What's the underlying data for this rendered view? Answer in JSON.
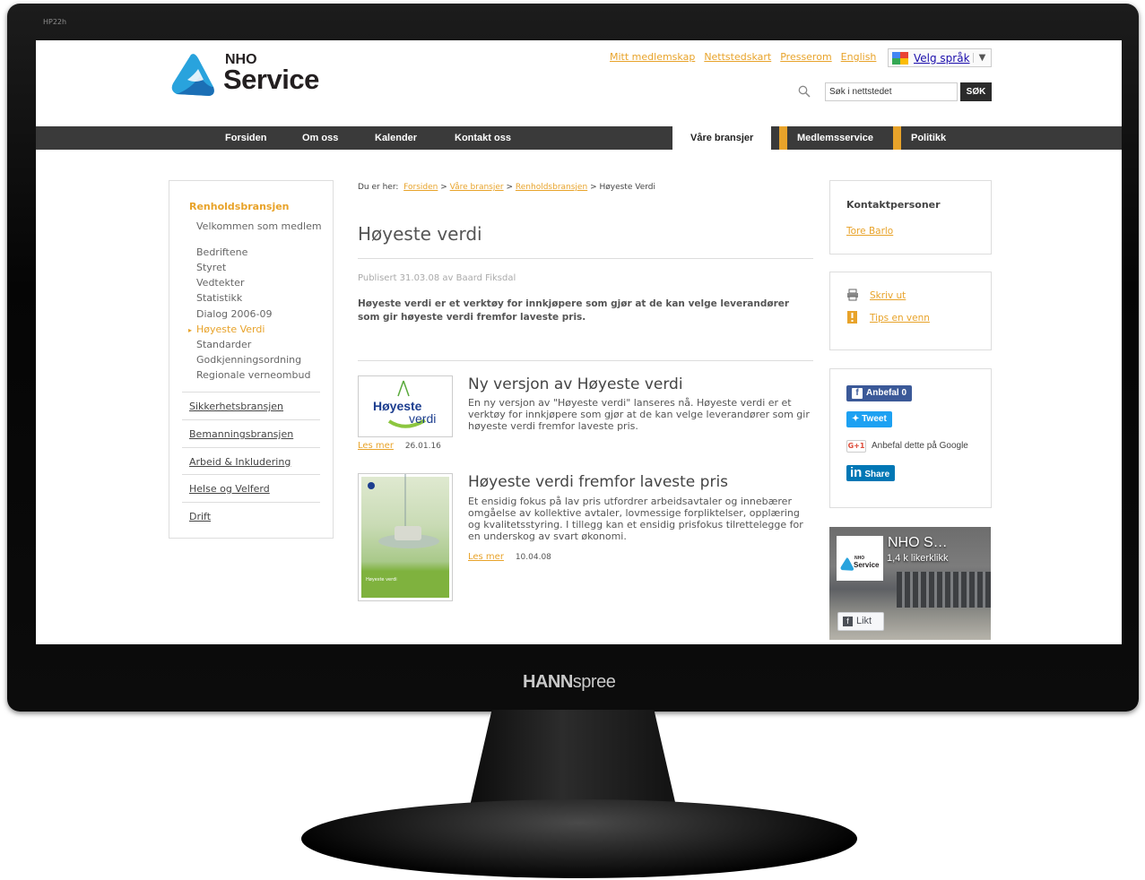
{
  "monitor": {
    "model": "HP22h",
    "brand_bold": "HANN",
    "brand_light": "spree"
  },
  "site": {
    "logo_nho": "NHO",
    "logo_service": "Service",
    "toplinks": [
      "Mitt medlemskap",
      "Nettstedskart",
      "Presserom",
      "English"
    ],
    "language_label": "Velg språk",
    "search_placeholder": "Søk i nettstedet",
    "search_button": "SØK",
    "nav": [
      "Forsiden",
      "Om oss",
      "Kalender",
      "Kontakt oss",
      "Våre bransjer",
      "Medlemsservice",
      "Politikk"
    ]
  },
  "sidebar": {
    "section": "Renholdsbransjen",
    "sub_items": [
      "Velkommen som medlem",
      "Bedriftene",
      "Styret",
      "Vedtekter",
      "Statistikk",
      "Dialog 2006-09",
      "Høyeste Verdi",
      "Standarder",
      "Godkjenningsordning",
      "Regionale verneombud"
    ],
    "active_index": 6,
    "main_items": [
      "Sikkerhetsbransjen",
      "Bemanningsbransjen",
      "Arbeid & Inkludering",
      "Helse og Velferd",
      "Drift"
    ]
  },
  "main": {
    "breadcrumb_prefix": "Du er her:",
    "breadcrumb_links": [
      "Forsiden",
      "Våre bransjer",
      "Renholdsbransjen"
    ],
    "breadcrumb_current": "Høyeste Verdi",
    "sep": ">",
    "title": "Høyeste verdi",
    "byline": "Publisert 31.03.08 av Baard Fiksdal",
    "lead": "Høyeste verdi er et verktøy for innkjøpere som gjør at de kan velge leverandører som gir høyeste verdi fremfor laveste pris.",
    "articles": [
      {
        "title": "Ny versjon av Høyeste verdi",
        "text": "En ny versjon av \"Høyeste verdi\" lanseres nå. Høyeste verdi er et verktøy for innkjøpere som gjør at de kan velge leverandører som gir høyeste verdi fremfor laveste pris.",
        "more": "Les mer",
        "date": "26.01.16",
        "thumb_line1": "Høyeste",
        "thumb_line2": "verdi"
      },
      {
        "title": "Høyeste verdi fremfor laveste pris",
        "text": "Et ensidig fokus på lav pris utfordrer arbeidsavtaler og innebærer omgåelse av kollektive avtaler, lovmessige forpliktelser, opplæring og kvalitetsstyring. I tillegg kan et ensidig prisfokus tilrettelegge for en underskog av svart økonomi.",
        "more": "Les mer",
        "date": "10.04.08",
        "thumb_caption": "Høyeste verdi"
      }
    ]
  },
  "right": {
    "contacts_title": "Kontaktpersoner",
    "contact_name": "Tore Barlo",
    "print_label": "Skriv ut",
    "tip_label": "Tips en venn",
    "fb_label": "Anbefal 0",
    "tweet_label": "Tweet",
    "gplus_badge": "G+1",
    "gplus_label": "Anbefal dette på Google",
    "linkedin_label": "Share",
    "linkedin_badge": "in",
    "fb_page_name": "NHO S…",
    "fb_page_likes": "1,4 k likerklikk",
    "fb_like_button": "Likt",
    "fb_logo_nho": "NHO",
    "fb_logo_service": "Service"
  },
  "colors": {
    "accent": "#e8a32a",
    "nav_bg": "#3a3a3a",
    "facebook": "#3b5998",
    "twitter": "#1da1f2",
    "linkedin": "#0077b5"
  }
}
